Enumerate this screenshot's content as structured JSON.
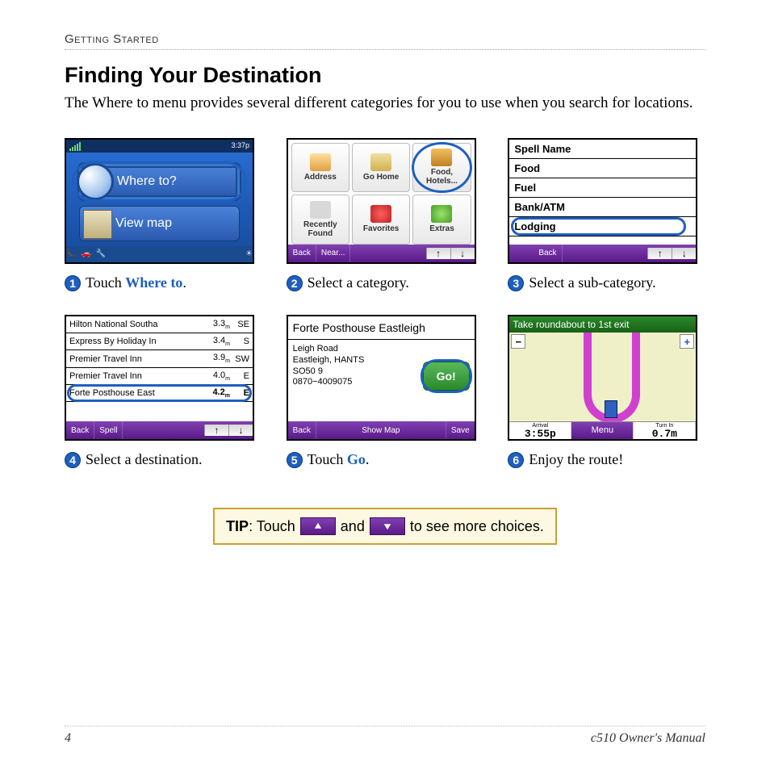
{
  "section": "Getting Started",
  "heading": "Finding Your Destination",
  "intro": "The Where to menu provides several different categories for you to use when you search for locations.",
  "steps": {
    "s1": {
      "num": "➊",
      "text_pre": "Touch ",
      "text_bold": "Where to",
      "text_post": "."
    },
    "s2": {
      "num": "➋",
      "text": "Select a category."
    },
    "s3": {
      "num": "➌",
      "text": "Select a sub-category."
    },
    "s4": {
      "num": "➍",
      "text": "Select a destination."
    },
    "s5": {
      "num": "➎",
      "text_pre": "Touch ",
      "text_bold": "Go",
      "text_post": "."
    },
    "s6": {
      "num": "➏",
      "text": "Enjoy the route!"
    }
  },
  "screen1": {
    "time": "3:37p",
    "where_to": "Where to?",
    "view_map": "View map"
  },
  "screen2": {
    "cells": [
      "Address",
      "Go Home",
      "Food, Hotels...",
      "Recently Found",
      "Favorites",
      "Extras"
    ],
    "back": "Back",
    "near": "Near..."
  },
  "screen3": {
    "rows": [
      "Spell Name",
      "Food",
      "Fuel",
      "Bank/ATM",
      "Lodging"
    ],
    "back": "Back"
  },
  "screen4": {
    "rows": [
      {
        "name": "Hilton National Southa",
        "dist": "3.3",
        "dir": "SE"
      },
      {
        "name": "Express By Holiday In",
        "dist": "3.4",
        "dir": "S"
      },
      {
        "name": "Premier Travel Inn",
        "dist": "3.9",
        "dir": "SW"
      },
      {
        "name": "Premier Travel Inn",
        "dist": "4.0",
        "dir": "E"
      },
      {
        "name": "Forte Posthouse East",
        "dist": "4.2",
        "dir": "E"
      }
    ],
    "back": "Back",
    "spell": "Spell"
  },
  "screen5": {
    "title": "Forte Posthouse Eastleigh",
    "addr1": "Leigh Road",
    "addr2": "Eastleigh, HANTS",
    "addr3": "SO50 9",
    "phone": "0870−4009075",
    "go": "Go!",
    "back": "Back",
    "showmap": "Show Map",
    "save": "Save"
  },
  "screen6": {
    "banner": "Take roundabout to 1st exit",
    "arrival_label": "Arrival",
    "arrival_val": "3:55p",
    "menu": "Menu",
    "turn_label": "Turn In",
    "turn_val": "0.7m"
  },
  "tip": {
    "label": "TIP",
    "pre": ": Touch ",
    "mid": " and ",
    "post": " to see more choices."
  },
  "footer": {
    "page": "4",
    "manual": "c510 Owner's Manual"
  }
}
